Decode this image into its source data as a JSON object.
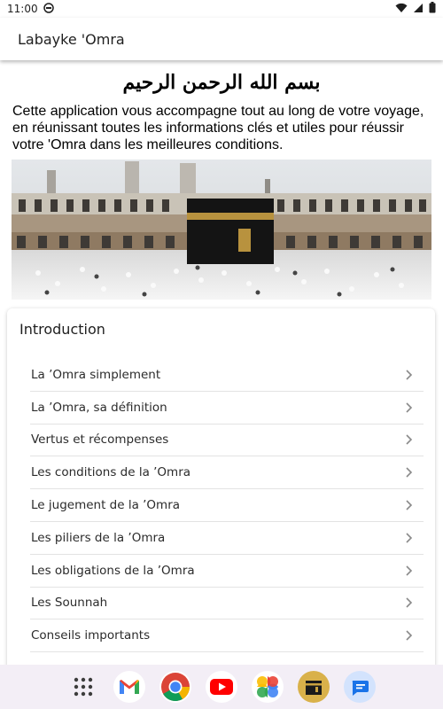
{
  "status_bar": {
    "time": "11:00"
  },
  "app_bar": {
    "title": "Labayke 'Omra"
  },
  "header": {
    "basmala": "بسم الله الرحمن الرحيم",
    "description": "Cette application vous accompagne tout au long de votre voyage, en réunissant toutes les informations clés et utiles pour réussir votre 'Omra dans les meilleures conditions."
  },
  "section": {
    "title": "Introduction",
    "items": [
      {
        "label": "La ’Omra simplement"
      },
      {
        "label": "La ’Omra, sa définition"
      },
      {
        "label": "Vertus et récompenses"
      },
      {
        "label": "Les conditions de la ’Omra"
      },
      {
        "label": "Le jugement de la ’Omra"
      },
      {
        "label": "Les piliers de la ’Omra"
      },
      {
        "label": "Les obligations de la ’Omra"
      },
      {
        "label": "Les Sounnah"
      },
      {
        "label": "Conseils importants"
      }
    ]
  },
  "dock": {
    "apps": [
      "app-drawer-icon",
      "gmail-icon",
      "chrome-icon",
      "youtube-icon",
      "photos-icon",
      "kaaba-app-icon",
      "messages-icon"
    ]
  },
  "colors": {
    "accent": "#1a73e8",
    "nav_bg": "#f3eef6"
  }
}
